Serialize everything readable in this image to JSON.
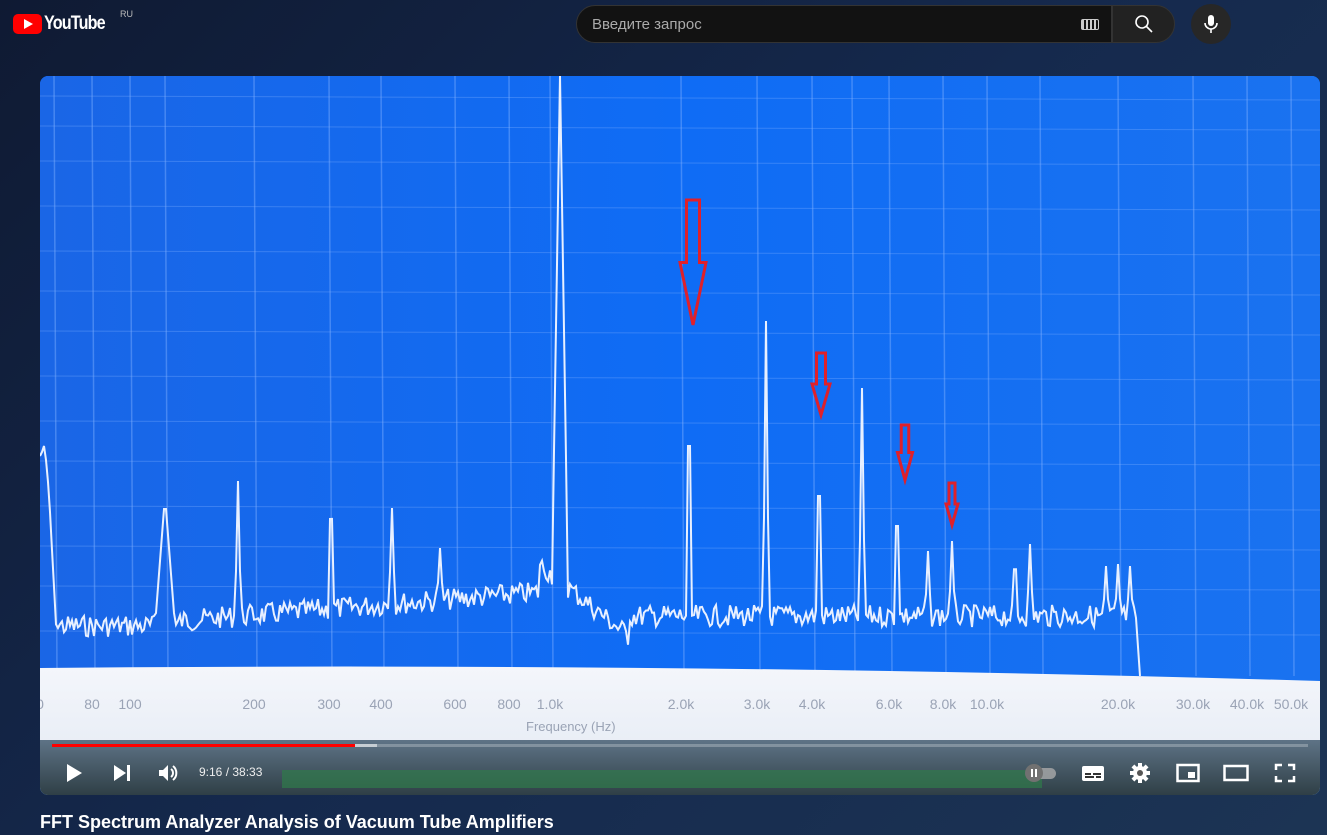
{
  "header": {
    "logo_text": "YouTube",
    "region": "RU",
    "search_placeholder": "Введите запрос",
    "icons": [
      "keyboard-icon",
      "search-icon",
      "mic-icon"
    ]
  },
  "video": {
    "frequency_labels": [
      "0",
      "80",
      "100",
      "200",
      "300",
      "400",
      "600",
      "800",
      "1.0k",
      "2.0k",
      "3.0k",
      "4.0k",
      "6.0k",
      "8.0k",
      "10.0k",
      "20.0k",
      "30.0k",
      "40.0k",
      "50.0k"
    ],
    "axis_title": "Frequency (Hz)",
    "colors": {
      "screen": "#0a6cf0",
      "trace": "#e8f0ff",
      "arrow": "#e0202a"
    }
  },
  "player": {
    "current_time": "9:16",
    "duration": "38:33",
    "time_display": "9:16 / 38:33",
    "progress_fraction": 0.241,
    "buffered_fraction": 0.259,
    "accent": "#ff0000"
  },
  "title": "FFT Spectrum Analyzer Analysis of Vacuum Tube Amplifiers"
}
